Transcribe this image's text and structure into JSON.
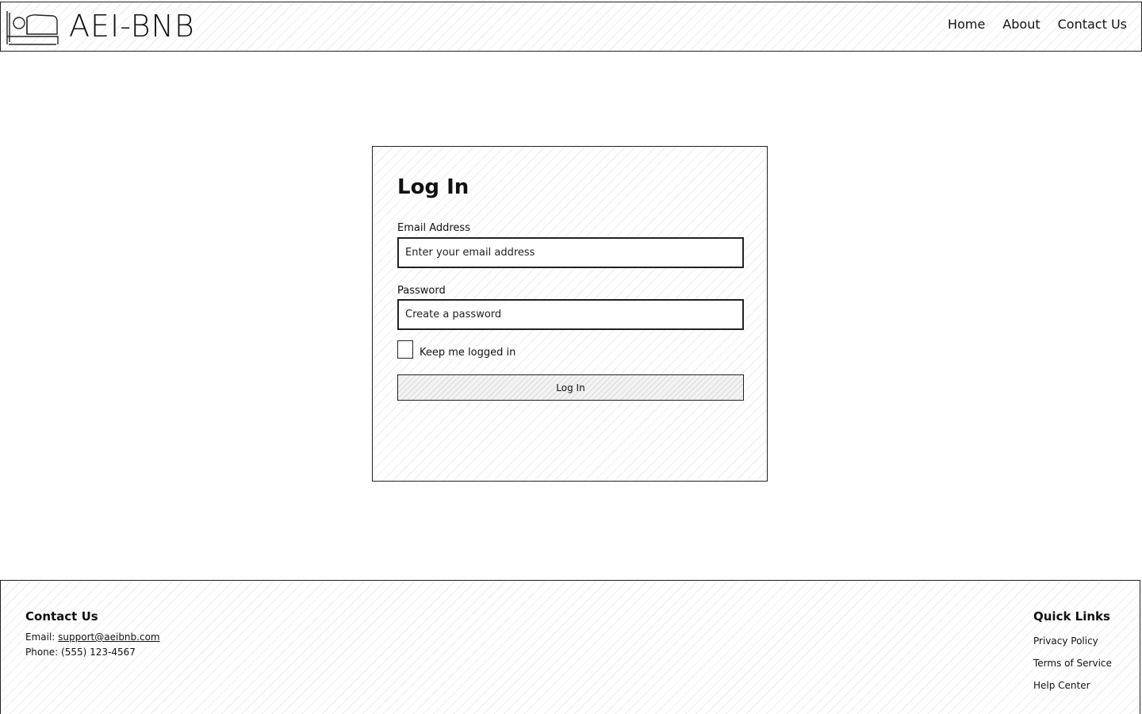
{
  "header": {
    "brand_name": "AEI-BNB",
    "logo_icon": "bed-icon",
    "nav": [
      {
        "label": "Home"
      },
      {
        "label": "About"
      },
      {
        "label": "Contact Us"
      }
    ]
  },
  "login": {
    "title": "Log In",
    "email_label": "Email Address",
    "email_placeholder": "Enter your email address",
    "email_value": "",
    "password_label": "Password",
    "password_placeholder": "Create a password",
    "password_value": "",
    "remember_label": "Keep me logged in",
    "remember_checked": false,
    "submit_label": "Log In"
  },
  "footer": {
    "contact": {
      "heading": "Contact Us",
      "email_prefix": "Email:",
      "email": "support@aeibnb.com",
      "phone": "Phone: (555) 123-4567"
    },
    "quick_links": {
      "heading": "Quick Links",
      "items": [
        {
          "label": "Privacy Policy"
        },
        {
          "label": "Terms of Service"
        },
        {
          "label": "Help Center"
        }
      ]
    }
  },
  "colors": {
    "stroke": "#222222",
    "text": "#111111",
    "background": "#ffffff"
  }
}
